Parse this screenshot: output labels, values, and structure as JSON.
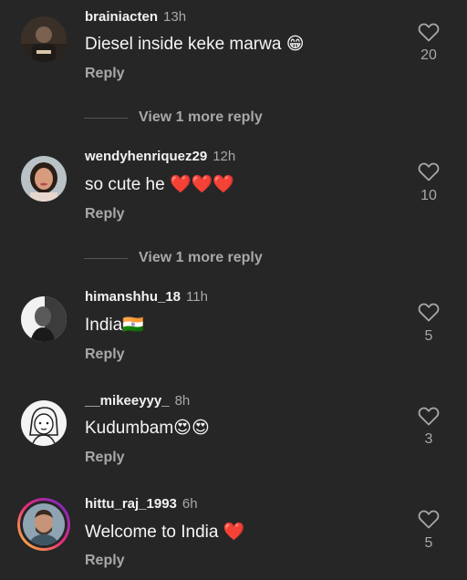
{
  "comments": [
    {
      "username": "brainiacten",
      "time": "13h",
      "text": "Diesel inside keke marwa 😁",
      "reply": "Reply",
      "likes": "20",
      "view_more": "View 1 more reply"
    },
    {
      "username": "wendyhenriquez29",
      "time": "12h",
      "text": "so cute he ❤️❤️❤️",
      "reply": "Reply",
      "likes": "10",
      "view_more": "View 1 more reply"
    },
    {
      "username": "himanshhu_18",
      "time": "11h",
      "text": "India🇮🇳",
      "reply": "Reply",
      "likes": "5"
    },
    {
      "username": "__mikeeyyy_",
      "time": "8h",
      "text": "Kudumbam😍😍",
      "reply": "Reply",
      "likes": "3"
    },
    {
      "username": "hittu_raj_1993",
      "time": "6h",
      "text": "Welcome to India ❤️",
      "reply": "Reply",
      "likes": "5"
    }
  ],
  "icons": {
    "like": "heart-outline-icon"
  },
  "colors": {
    "background": "#262626",
    "secondary_text": "#a8a8a8",
    "primary_text": "#f5f5f5"
  }
}
